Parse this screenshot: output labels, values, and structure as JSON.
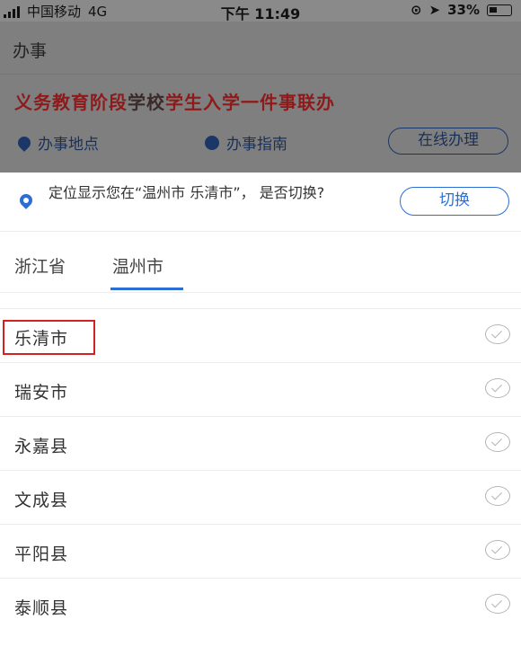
{
  "status_bar": {
    "carrier": "中国移动",
    "network": "4G",
    "time": "下午 11:49",
    "battery": "33%"
  },
  "header": {
    "title": "办事"
  },
  "banner": {
    "part1": "义务教育阶段",
    "part2": "学校",
    "part3": "学生入学一件事联办"
  },
  "links": {
    "location": "办事地点",
    "guide": "办事指南",
    "online": "在线办理"
  },
  "location_prompt": {
    "text": "定位显示您在“温州市 乐清市”， 是否切换?",
    "switch_label": "切换"
  },
  "tabs": [
    {
      "label": "浙江省"
    },
    {
      "label": "温州市"
    }
  ],
  "list": [
    {
      "label": "乐清市"
    },
    {
      "label": "瑞安市"
    },
    {
      "label": "永嘉县"
    },
    {
      "label": "文成县"
    },
    {
      "label": "平阳县"
    },
    {
      "label": "泰顺县"
    }
  ],
  "colors": {
    "accent": "#2a6ed6",
    "overlay": "#7f7f7f",
    "highlight": "#d32020"
  }
}
